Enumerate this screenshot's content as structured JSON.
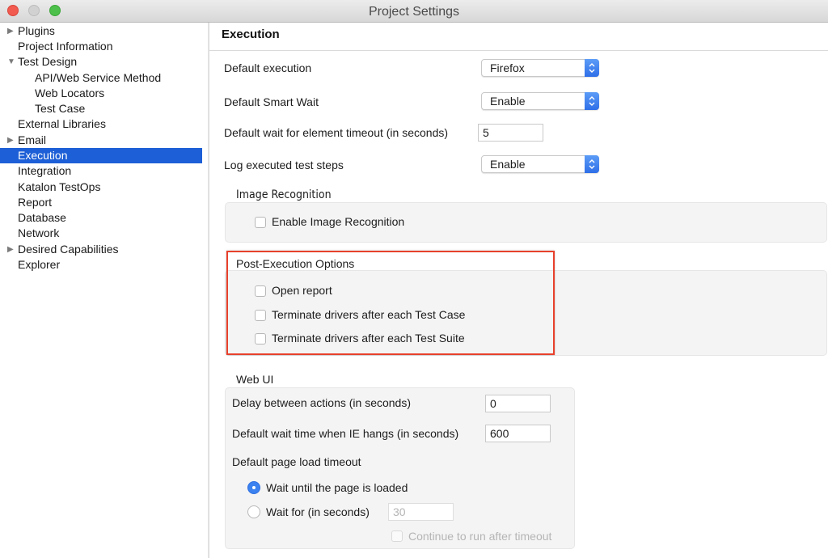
{
  "window": {
    "title": "Project Settings",
    "controls": [
      "close",
      "minimize",
      "maximize"
    ]
  },
  "sidebar": {
    "items": [
      {
        "label": "Plugins",
        "expander": "collapsed",
        "level": 0
      },
      {
        "label": "Project Information",
        "expander": "none",
        "level": 0
      },
      {
        "label": "Test Design",
        "expander": "expanded",
        "level": 0
      },
      {
        "label": "API/Web Service Method",
        "expander": "none",
        "level": 1
      },
      {
        "label": "Web Locators",
        "expander": "none",
        "level": 1
      },
      {
        "label": "Test Case",
        "expander": "none",
        "level": 1
      },
      {
        "label": "External Libraries",
        "expander": "none",
        "level": 0
      },
      {
        "label": "Email",
        "expander": "collapsed",
        "level": 0
      },
      {
        "label": "Execution",
        "expander": "none",
        "level": 0,
        "selected": true
      },
      {
        "label": "Integration",
        "expander": "none",
        "level": 0
      },
      {
        "label": "Katalon TestOps",
        "expander": "none",
        "level": 0
      },
      {
        "label": "Report",
        "expander": "none",
        "level": 0
      },
      {
        "label": "Database",
        "expander": "none",
        "level": 0
      },
      {
        "label": "Network",
        "expander": "none",
        "level": 0
      },
      {
        "label": "Desired Capabilities",
        "expander": "collapsed",
        "level": 0
      },
      {
        "label": "Explorer",
        "expander": "none",
        "level": 0
      }
    ]
  },
  "main": {
    "title": "Execution",
    "general": {
      "default_execution": {
        "label": "Default execution",
        "value": "Firefox"
      },
      "default_smart_wait": {
        "label": "Default Smart Wait",
        "value": "Enable"
      },
      "default_wait_timeout": {
        "label": "Default wait for element timeout (in seconds)",
        "value": "5"
      },
      "log_executed_steps": {
        "label": "Log executed test steps",
        "value": "Enable"
      }
    },
    "image_recognition": {
      "title": "Image Recognition",
      "enable": {
        "label": "Enable Image Recognition",
        "checked": false
      }
    },
    "post_execution": {
      "title": "Post-Execution Options",
      "options": [
        {
          "label": "Open report",
          "checked": false
        },
        {
          "label": "Terminate drivers after each Test Case",
          "checked": false
        },
        {
          "label": "Terminate drivers after each Test Suite",
          "checked": false
        }
      ],
      "highlight_color": "#e8412c"
    },
    "web_ui": {
      "title": "Web UI",
      "delay_between_actions": {
        "label": "Delay between actions (in seconds)",
        "value": "0"
      },
      "ie_hang_wait": {
        "label": "Default wait time when IE hangs (in seconds)",
        "value": "600"
      },
      "page_load_timeout": {
        "label": "Default page load timeout",
        "wait_until_loaded": {
          "label": "Wait until the page is loaded",
          "selected": true
        },
        "wait_for": {
          "label": "Wait for (in seconds)",
          "selected": false,
          "value": "30",
          "disabled": true
        },
        "continue_after_timeout": {
          "label": "Continue to run after timeout",
          "checked": false,
          "disabled": true
        }
      }
    }
  },
  "colors": {
    "selection": "#1d5fd6",
    "accent": "#3b82f0",
    "highlight": "#e8412c"
  }
}
